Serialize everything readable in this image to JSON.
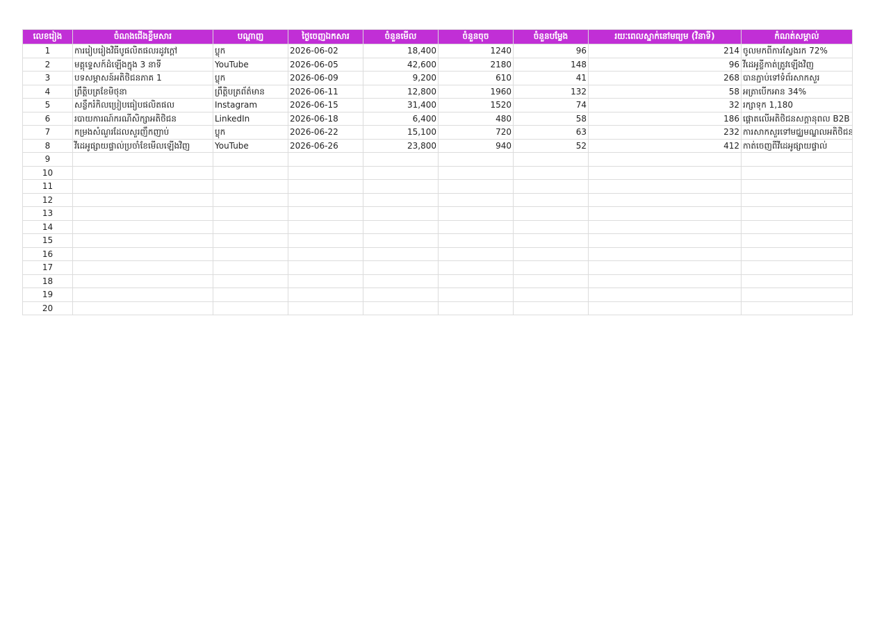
{
  "sheet": {
    "header_color": "#c12fd6",
    "columns": [
      "លេខរៀង",
      "ចំណងជើងខ្លឹមសារ",
      "បណ្តាញ",
      "ថ្ងៃចេញឯកសារ",
      "ចំនួនមើល",
      "ចំនួនចុច",
      "ចំនួនបម្លែង",
      "រយៈពេលស្នាក់នៅមធ្យម (វិនាទី)",
      "កំណត់សម្គាល់"
    ],
    "rows": [
      [
        "1",
        "ការរៀបរៀងវិធីបូផលិតផលរដូវក្តៅ",
        "ប្លុក",
        "2026-06-02",
        "18,400",
        "1240",
        "96",
        "214",
        "ចូលមកពីការស្វែងរក 72%"
      ],
      [
        "2",
        "មគ្គុទ្ទេសក៍ដំឡើងក្នុង 3 នាទី",
        "YouTube",
        "2026-06-05",
        "42,600",
        "2180",
        "148",
        "96",
        "វីដេអូខ្លីកាត់ត្រូវឡើងវិញ"
      ],
      [
        "3",
        "បទសម្ភាសន៍អតិថិជនភាគ 1",
        "ប្លុក",
        "2026-06-09",
        "9,200",
        "610",
        "41",
        "268",
        "បានភ្ជាប់ទៅទំព័រសាកសួរ"
      ],
      [
        "4",
        "ព្រឹត្តិបត្រខែមិថុនា",
        "ព្រឹត្តិបត្រព័ត៌មាន",
        "2026-06-11",
        "12,800",
        "1960",
        "132",
        "58",
        "អត្រាបើកអាន 34%"
      ],
      [
        "5",
        "សន្លឹករំកិលប្រៀបធៀបផលិតផល",
        "Instagram",
        "2026-06-15",
        "31,400",
        "1520",
        "74",
        "32",
        "រក្សាទុក 1,180"
      ],
      [
        "6",
        "របាយការណ៍ករណីសិក្សាអតិថិជន",
        "LinkedIn",
        "2026-06-18",
        "6,400",
        "480",
        "58",
        "186",
        "ផ្តោតលើអតិថិជនសក្តានុពល B2B"
      ],
      [
        "7",
        "កម្រងសំណួរដែលសួរញឹកញាប់",
        "ប្លុក",
        "2026-06-22",
        "15,100",
        "720",
        "63",
        "232",
        "ការសាកសួរទៅមជ្ឈមណ្ឌលអតិថិជនថយចុះ"
      ],
      [
        "8",
        "វីដេអូផ្សាយផ្ទាល់ប្រចាំខែមើលឡើងវិញ",
        "YouTube",
        "2026-06-26",
        "23,800",
        "940",
        "52",
        "412",
        "កាត់ចេញពីវីដេអូផ្សាយផ្ទាល់"
      ],
      [
        "9",
        "",
        "",
        "",
        "",
        "",
        "",
        "",
        ""
      ],
      [
        "10",
        "",
        "",
        "",
        "",
        "",
        "",
        "",
        ""
      ],
      [
        "11",
        "",
        "",
        "",
        "",
        "",
        "",
        "",
        ""
      ],
      [
        "12",
        "",
        "",
        "",
        "",
        "",
        "",
        "",
        ""
      ],
      [
        "13",
        "",
        "",
        "",
        "",
        "",
        "",
        "",
        ""
      ],
      [
        "14",
        "",
        "",
        "",
        "",
        "",
        "",
        "",
        ""
      ],
      [
        "15",
        "",
        "",
        "",
        "",
        "",
        "",
        "",
        ""
      ],
      [
        "16",
        "",
        "",
        "",
        "",
        "",
        "",
        "",
        ""
      ],
      [
        "17",
        "",
        "",
        "",
        "",
        "",
        "",
        "",
        ""
      ],
      [
        "18",
        "",
        "",
        "",
        "",
        "",
        "",
        "",
        ""
      ],
      [
        "19",
        "",
        "",
        "",
        "",
        "",
        "",
        "",
        ""
      ],
      [
        "20",
        "",
        "",
        "",
        "",
        "",
        "",
        "",
        ""
      ]
    ]
  }
}
